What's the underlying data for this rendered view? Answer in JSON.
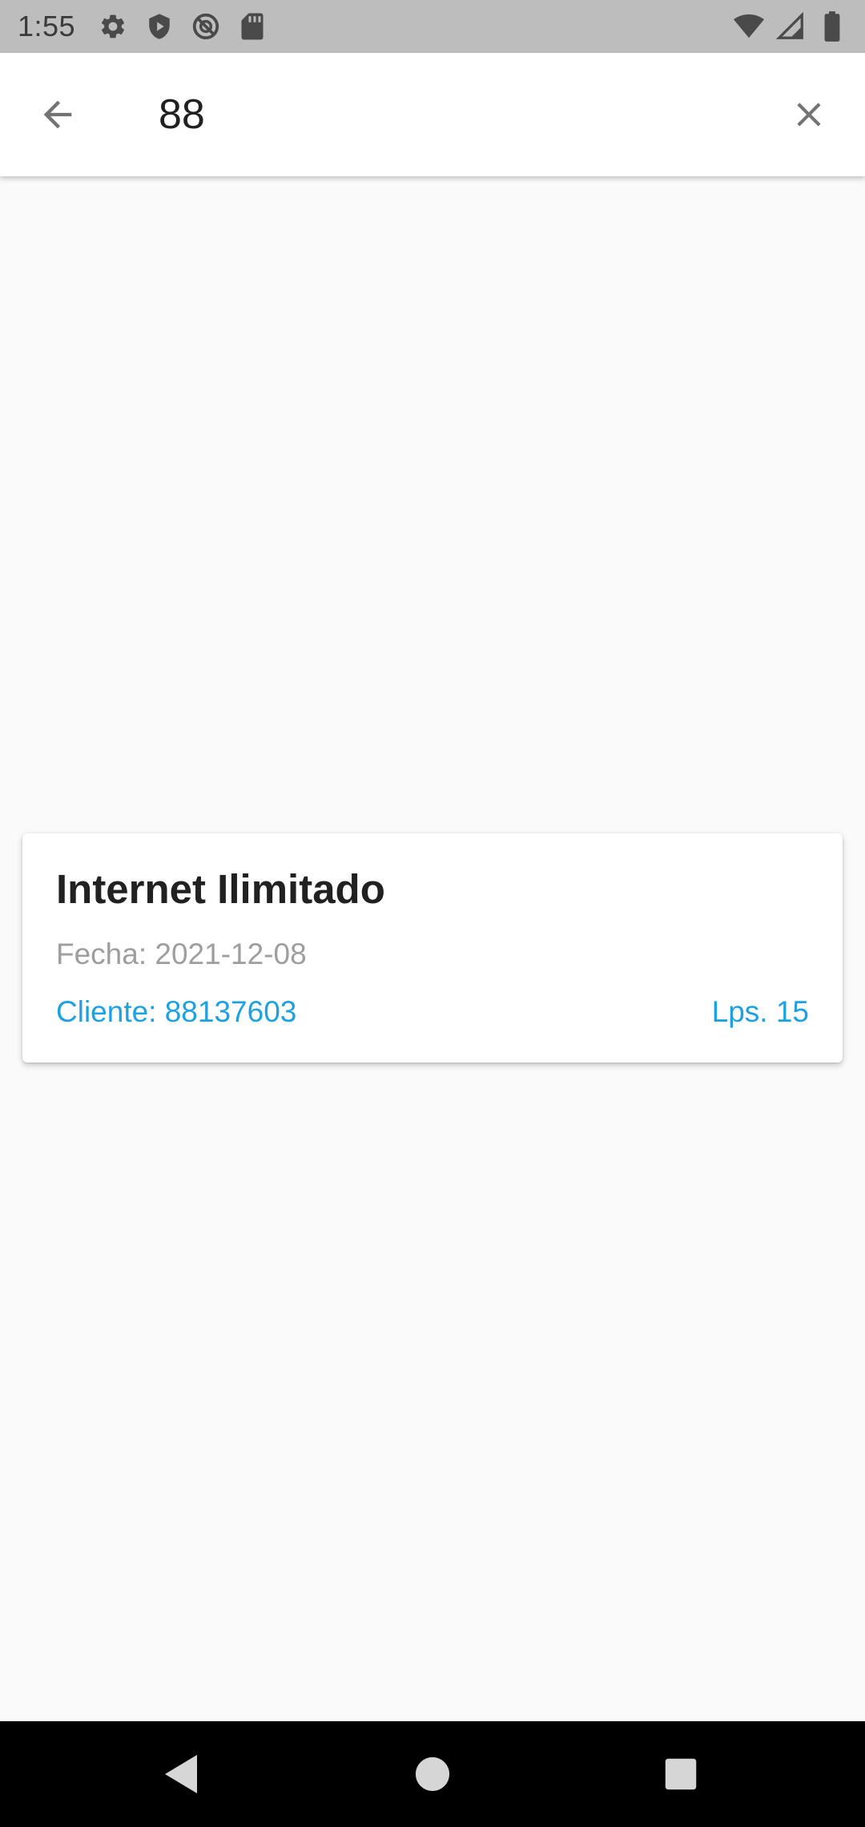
{
  "status_bar": {
    "time": "1:55",
    "left_icons": [
      "settings-icon",
      "play-protect-icon",
      "no-disturb-icon",
      "sd-card-icon"
    ],
    "right_icons": [
      "wifi-icon",
      "cell-signal-icon",
      "battery-icon"
    ]
  },
  "search": {
    "value": "88",
    "back_icon": "arrow-left-icon",
    "clear_icon": "close-icon"
  },
  "results": [
    {
      "title": "Internet Ilimitado",
      "date": "Fecha: 2021-12-08",
      "client": "Cliente: 88137603",
      "amount": "Lps. 15"
    }
  ],
  "nav_bar": {
    "icons": [
      "nav-back-icon",
      "nav-home-icon",
      "nav-recents-icon"
    ]
  },
  "colors": {
    "accent": "#1ea1e0",
    "status_bar_bg": "#bdbdbd",
    "background": "#fafafa",
    "card_bg": "#ffffff",
    "title_text": "#212121",
    "secondary_text": "#9e9e9e"
  }
}
